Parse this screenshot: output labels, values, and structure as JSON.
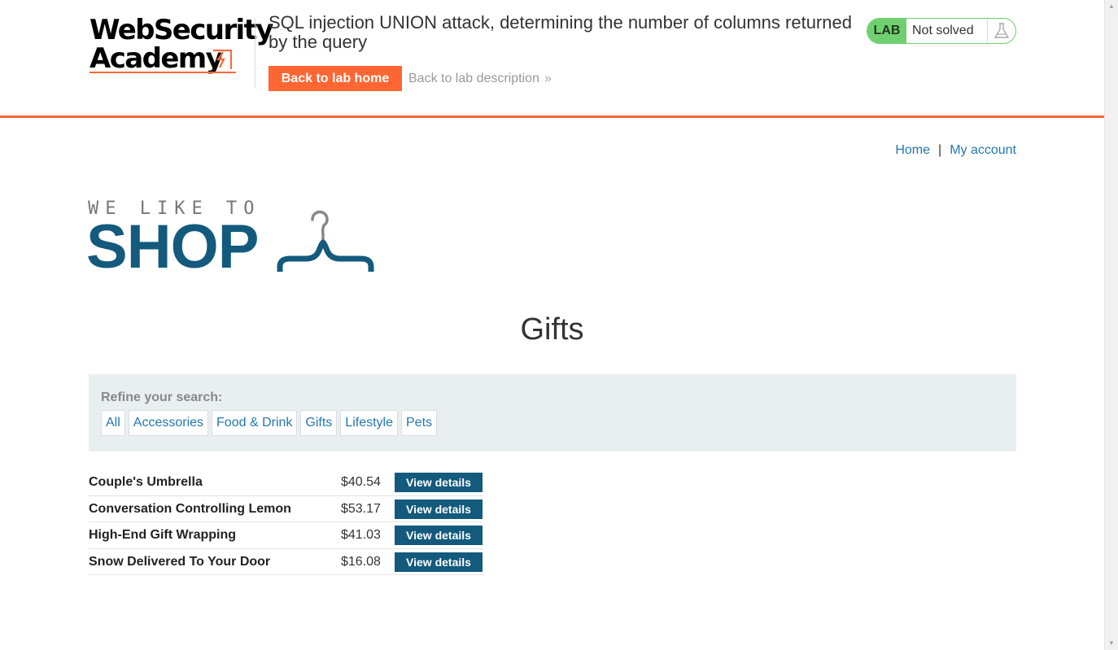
{
  "academy": {
    "logo_line1": "WebSecurity",
    "logo_line2": "Academy",
    "lab_title": "SQL injection UNION attack, determining the number of columns returned by the query",
    "back_home_label": "Back to lab home",
    "back_description_label": "Back to lab description",
    "lab_badge": "LAB",
    "lab_status": "Not solved",
    "accent_color": "#ff6633",
    "status_color": "#70d070"
  },
  "nav": {
    "home_label": "Home",
    "separator": "|",
    "account_label": "My account"
  },
  "shop_logo": {
    "tagline": "WE LIKE TO",
    "word": "SHOP",
    "brand_color": "#135a7d"
  },
  "page": {
    "title": "Gifts"
  },
  "refine": {
    "label": "Refine your search:",
    "filters": [
      "All",
      "Accessories",
      "Food & Drink",
      "Gifts",
      "Lifestyle",
      "Pets"
    ]
  },
  "products": [
    {
      "name": "Couple's Umbrella",
      "price": "$40.54",
      "button": "View details"
    },
    {
      "name": "Conversation Controlling Lemon",
      "price": "$53.17",
      "button": "View details"
    },
    {
      "name": "High-End Gift Wrapping",
      "price": "$41.03",
      "button": "View details"
    },
    {
      "name": "Snow Delivered To Your Door",
      "price": "$16.08",
      "button": "View details"
    }
  ]
}
